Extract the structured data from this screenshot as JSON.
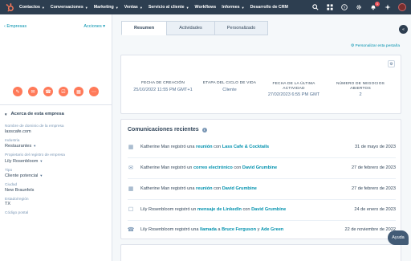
{
  "nav": {
    "items": [
      {
        "label": "Contactos"
      },
      {
        "label": "Conversaciones"
      },
      {
        "label": "Marketing"
      },
      {
        "label": "Ventas"
      },
      {
        "label": "Servicio al cliente"
      },
      {
        "label": "Workflows"
      },
      {
        "label": "Informes"
      },
      {
        "label": "Desarrollo de CRM"
      }
    ],
    "notification_count": "1",
    "brand_color": "#ff7a59"
  },
  "sidebar": {
    "back_link": "‹ Empresas",
    "actions_label": "Acciones ▾",
    "section_title": "Acerca de esta empresa",
    "properties": [
      {
        "label": "Nombre de dominio de la empresa",
        "value": "lasscafe.com"
      },
      {
        "label": "Industria",
        "value": "Restaurantes"
      },
      {
        "label": "Propietario del registro de empresa",
        "value": "Lily Rosenbloom"
      },
      {
        "label": "Tipo",
        "value": "Cliente potencial"
      },
      {
        "label": "Ciudad",
        "value": "New Braunfels"
      },
      {
        "label": "Estado/región",
        "value": "TX"
      },
      {
        "label": "Código postal",
        "value": ""
      }
    ]
  },
  "main": {
    "tabs": [
      {
        "label": "Resumen"
      },
      {
        "label": "Actividades"
      },
      {
        "label": "Personalizado"
      }
    ],
    "customize_link": "⚙ Personalizar esta pestaña",
    "highlights": [
      {
        "label": "FECHA DE CREACIÓN",
        "value": "25/10/2022 11:55 PM GMT+1"
      },
      {
        "label": "ETAPA DEL CICLO DE VIDA",
        "value": "Cliente"
      },
      {
        "label": "FECHA DE LA ÚLTIMA ACTIVIDAD",
        "value": "27/02/2023 6:55 PM GMT"
      },
      {
        "label": "NÚMERO DE NEGOCIOS ABIERTOS",
        "value": "2"
      }
    ],
    "communications": {
      "title": "Comunicaciones recientes",
      "rows": [
        {
          "actor": "Katherine Man registró una",
          "link1": "reunión",
          "mid": "con",
          "link2": "Lass Cafe & Cocktails",
          "date": "31 de mayo de 2023",
          "icon": "calendar-icon"
        },
        {
          "actor": "Katherine Man registró un",
          "link1": "correo electrónico",
          "mid": "con",
          "link2": "David Grumbine",
          "date": "27 de febrero de 2023",
          "icon": "email-icon"
        },
        {
          "actor": "Katherine Man registró una",
          "link1": "reunión",
          "mid": "con",
          "link2": "David Grumbine",
          "date": "27 de febrero de 2023",
          "icon": "calendar-icon"
        },
        {
          "actor": "Lily Rosenbloom registró un",
          "link1": "mensaje de LinkedIn",
          "mid": "con",
          "link2": "David Grumbine",
          "date": "24 de enero de 2023",
          "icon": "chat-icon"
        },
        {
          "actor": "Lily Rosenbloom registró una",
          "link1": "llamada",
          "mid": "a",
          "link2": "Bruce Ferguson",
          "and": "y",
          "link3": "Ade Green",
          "date": "22 de noviembre de 2022",
          "icon": "phone-icon"
        }
      ]
    }
  },
  "help_label": "Ayuda"
}
